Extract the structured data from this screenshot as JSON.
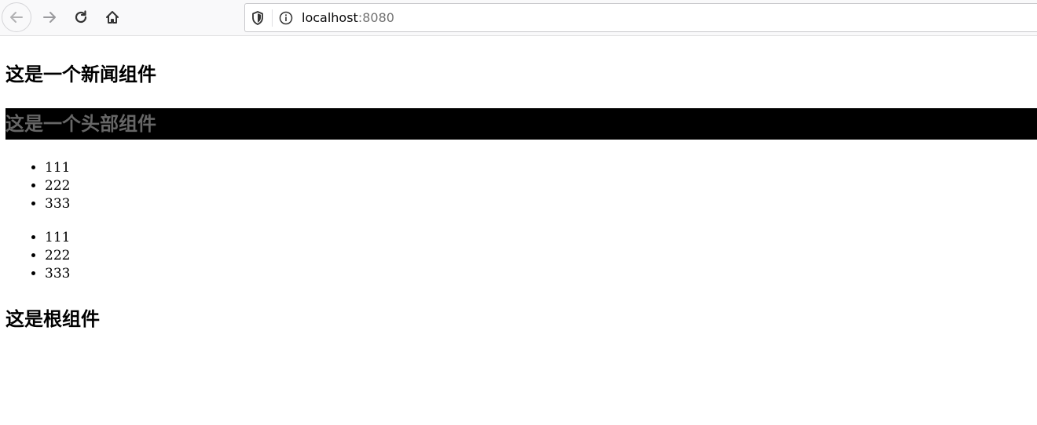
{
  "browser": {
    "url_host": "localhost",
    "url_port": ":8080",
    "icons": {
      "back": "arrow-left-icon",
      "forward": "arrow-right-icon",
      "reload": "reload-icon",
      "home": "home-icon",
      "shield": "shield-icon",
      "info": "info-icon"
    }
  },
  "page": {
    "news_title": "这是一个新闻组件",
    "header_title": "这是一个头部组件",
    "list_one": [
      "111",
      "222",
      "333"
    ],
    "list_two": [
      "111",
      "222",
      "333"
    ],
    "root_title": "这是根组件"
  },
  "colors": {
    "header_background": "#000000",
    "header_text": "#666666"
  }
}
